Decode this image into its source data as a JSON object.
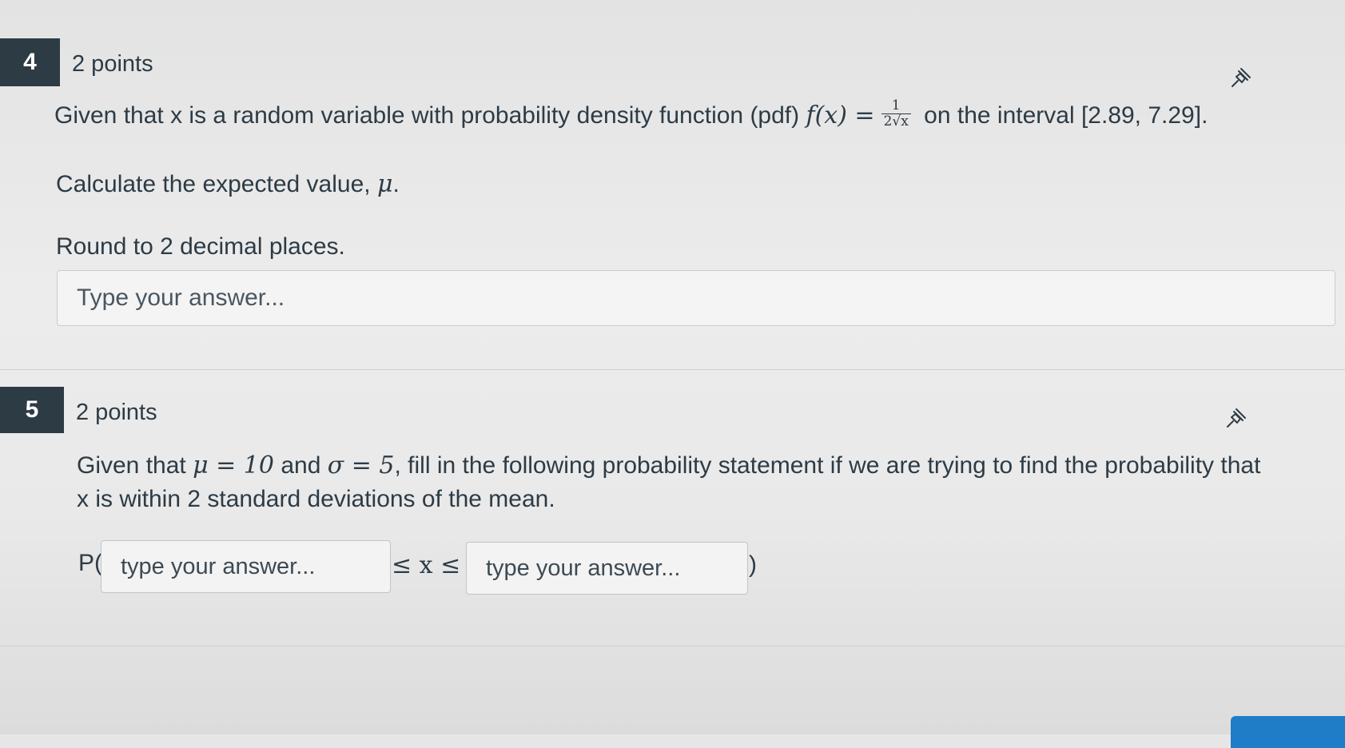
{
  "questions": [
    {
      "number": "4",
      "points": "2 points",
      "text_before": "Given that x is a random variable with probability density function (pdf)",
      "formula_lhs": "f(x) =",
      "frac_num": "1",
      "frac_den": "2√x",
      "text_after": "on the interval [2.89, 7.29].",
      "line2": "Calculate the expected value,",
      "line2_symbol": "μ",
      "line2_end": ".",
      "line3": "Round to 2 decimal places.",
      "answer_placeholder": "Type your answer..."
    },
    {
      "number": "5",
      "points": "2 points",
      "text_part1": "Given that",
      "mu_expr": "μ = 10",
      "text_part2": "and",
      "sigma_expr": "σ = 5",
      "text_part3": ", fill in the following probability statement if we are trying to find the probability that",
      "line2": "x is within 2 standard deviations of the mean.",
      "prob_open": "P(",
      "lower_placeholder": "type your answer...",
      "middle_expr": "≤ x ≤",
      "upper_placeholder": "type your answer...",
      "prob_close": ")"
    }
  ],
  "icons": {
    "pin": "pin-icon"
  },
  "colors": {
    "badge": "#2d3b45",
    "button": "#1f7cc6"
  }
}
